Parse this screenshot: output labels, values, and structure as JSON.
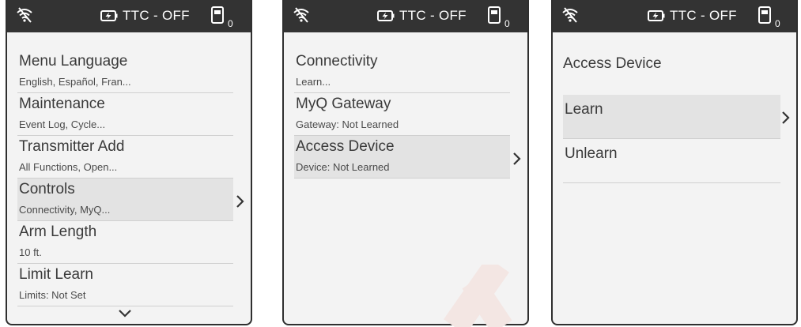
{
  "status_bar": {
    "ttc_label": "TTC - OFF",
    "remote_count": "0",
    "icons": [
      "wifi-off-icon",
      "battery-charging-icon",
      "remote-icon"
    ]
  },
  "screen1": {
    "items": [
      {
        "title": "Menu Language",
        "subtitle": "English, Español, Fran..."
      },
      {
        "title": "Maintenance",
        "subtitle": "Event Log, Cycle..."
      },
      {
        "title": "Transmitter Add",
        "subtitle": "All Functions, Open..."
      },
      {
        "title": "Controls",
        "subtitle": "Connectivity, MyQ..."
      },
      {
        "title": "Arm Length",
        "subtitle": "10 ft."
      },
      {
        "title": "Limit Learn",
        "subtitle": "Limits: Not Set"
      }
    ],
    "selected_index": 3
  },
  "screen2": {
    "items": [
      {
        "title": "Connectivity",
        "subtitle": "Learn..."
      },
      {
        "title": "MyQ Gateway",
        "subtitle": "Gateway: Not Learned"
      },
      {
        "title": "Access Device",
        "subtitle": "Device: Not Learned"
      }
    ],
    "selected_index": 2
  },
  "screen3": {
    "title": "Access Device",
    "items": [
      {
        "title": "Learn"
      },
      {
        "title": "Unlearn"
      }
    ],
    "selected_index": 0
  },
  "colors": {
    "status_bar": "#333333",
    "screen_bg": "#f3f3f3",
    "selected_bg": "#e3e3e3",
    "watermark": "#f3e6e3"
  }
}
